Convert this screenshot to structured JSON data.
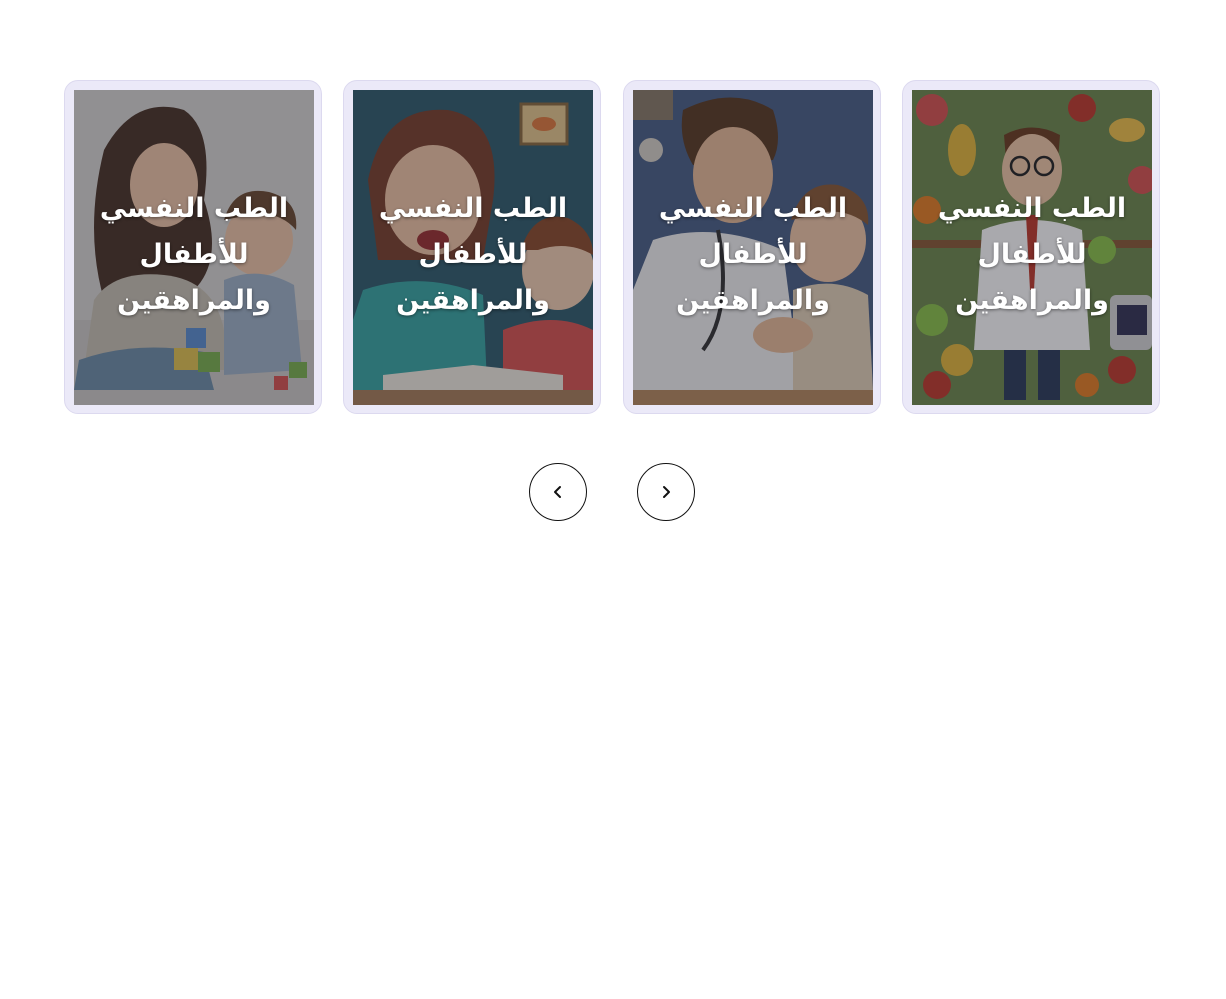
{
  "carousel": {
    "cards": [
      {
        "title": "الطب النفسي للأطفال والمراهقين",
        "image": "mother-child-blocks-illustration"
      },
      {
        "title": "الطب النفسي للأطفال والمراهقين",
        "image": "teacher-child-reading-illustration"
      },
      {
        "title": "الطب النفسي للأطفال والمراهقين",
        "image": "doctor-child-checkup-illustration"
      },
      {
        "title": "الطب النفسي للأطفال والمراهقين",
        "image": "nutritionist-fruits-illustration"
      }
    ],
    "controls": {
      "prev_icon": "chevron-left-icon",
      "next_icon": "chevron-right-icon"
    }
  }
}
